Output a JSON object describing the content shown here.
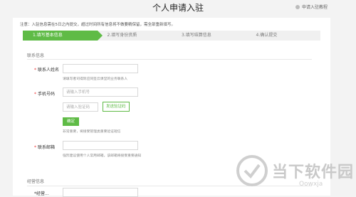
{
  "header": {
    "title": "个人申请入驻",
    "tutorial_label": "申请入驻教程"
  },
  "notice": "注意：入驻信息需在5日之内提交，超过时间所有信息将不做要精保留，需全部重新填写。",
  "steps": [
    {
      "label": "1.填写基本信息",
      "active": true
    },
    {
      "label": "2.填写身份资质",
      "active": false
    },
    {
      "label": "3.填写结算信息",
      "active": false
    },
    {
      "label": "4.确认提交",
      "active": false
    }
  ],
  "contact_section": {
    "title": "联系信息",
    "name_label": "联系人姓名",
    "name_hint": "请填写者司得际应同签云课堂的业务联系人",
    "phone_label": "手机号码",
    "phone_placeholder": "请输入手机号",
    "code_placeholder": "请输入验证码",
    "send_code_label": "发送验证码",
    "confirm_label": "确定",
    "phone_hint": "非常重要，将接受管理类重要验证短信",
    "email_label": "联系邮箱",
    "email_hint": "强烈建议使用个人常用邮箱，该邮箱将接受重要通知"
  },
  "business_section": {
    "title": "经营信息",
    "field_label": "*经营..."
  },
  "watermark": {
    "text": "当下软件园",
    "subtext": "Oowxja"
  },
  "colors": {
    "accent": "#5fbb46",
    "required": "#e33333"
  }
}
